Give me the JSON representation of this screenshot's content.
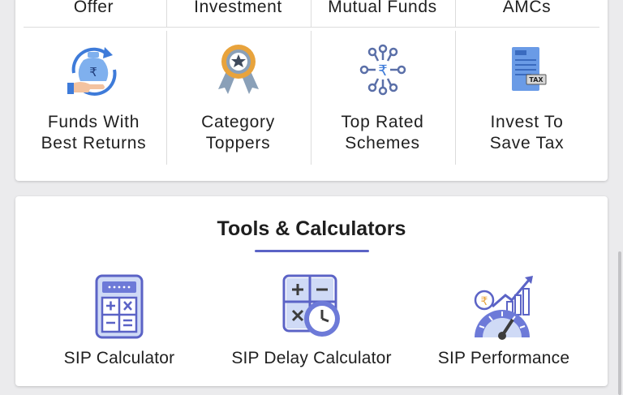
{
  "top_row": [
    "Offer",
    "Investment",
    "Mutual Funds",
    "AMCs"
  ],
  "grid": [
    {
      "label": "Funds With\nBest Returns",
      "icon": "money-bag-returns-icon"
    },
    {
      "label": "Category\nToppers",
      "icon": "award-badge-icon"
    },
    {
      "label": "Top Rated\nSchemes",
      "icon": "rupee-network-icon"
    },
    {
      "label": "Invest To\nSave Tax",
      "icon": "tax-document-icon"
    }
  ],
  "tools": {
    "title": "Tools & Calculators",
    "items": [
      {
        "label": "SIP Calculator",
        "icon": "calculator-icon"
      },
      {
        "label": "SIP Delay Calculator",
        "icon": "calculator-clock-icon"
      },
      {
        "label": "SIP Performance",
        "icon": "performance-gauge-icon"
      }
    ]
  },
  "colors": {
    "accent": "#5b63c6",
    "icon_blue": "#4a7fd6",
    "icon_gold": "#e8a33c"
  }
}
